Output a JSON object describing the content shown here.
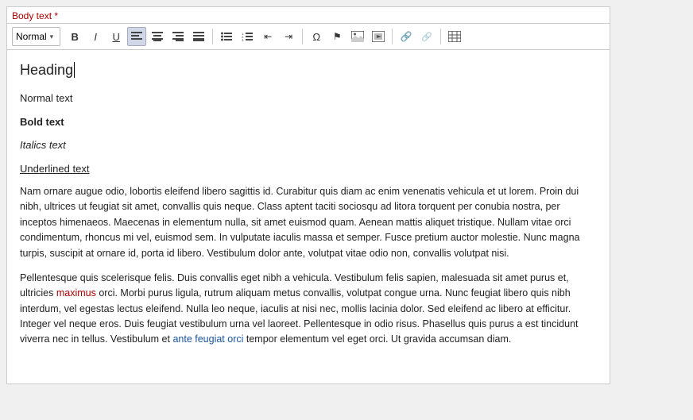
{
  "label": {
    "title": "Body text *"
  },
  "toolbar": {
    "style_select": "Normal",
    "buttons": [
      {
        "name": "bold-button",
        "label": "B",
        "style": "bold"
      },
      {
        "name": "italic-button",
        "label": "I",
        "style": "italic"
      },
      {
        "name": "underline-button",
        "label": "U",
        "style": "underline"
      },
      {
        "name": "align-left-button",
        "label": "≡",
        "icon": "align-left"
      },
      {
        "name": "align-center-button",
        "label": "≡",
        "icon": "align-center"
      },
      {
        "name": "align-right-button",
        "label": "≡",
        "icon": "align-right"
      },
      {
        "name": "justify-button",
        "label": "≡",
        "icon": "justify"
      },
      {
        "name": "list-unordered-button",
        "label": "☰",
        "icon": "ul"
      },
      {
        "name": "list-ordered-button",
        "label": "☰",
        "icon": "ol"
      },
      {
        "name": "indent-decrease-button",
        "label": "⇤"
      },
      {
        "name": "indent-increase-button",
        "label": "⇥"
      },
      {
        "name": "special-char-button",
        "label": "Ω"
      },
      {
        "name": "flag-button",
        "label": "⚑"
      },
      {
        "name": "image-button",
        "label": "⬛"
      },
      {
        "name": "table-special-button",
        "label": "⬛"
      },
      {
        "name": "link-button",
        "label": "🔗"
      },
      {
        "name": "unlink-button",
        "label": "🔗"
      },
      {
        "name": "table-button",
        "label": "⊞"
      }
    ]
  },
  "content": {
    "heading": "Heading",
    "normal_text": "Normal text",
    "bold_text": "Bold text",
    "italics_text": "Italics text",
    "underlined_text": "Underlined text",
    "paragraph1": "Nam ornare augue odio, lobortis eleifend libero sagittis id. Curabitur quis diam ac enim venenatis vehicula et ut lorem. Proin dui nibh, ultrices ut feugiat sit amet, convallis quis neque. Class aptent taciti sociosqu ad litora torquent per conubia nostra, per inceptos himenaeos. Maecenas in elementum nulla, sit amet euismod quam. Aenean mattis aliquet tristique. Nullam vitae orci condimentum, rhoncus mi vel, euismod sem. In vulputate iaculis massa et semper. Fusce pretium auctor molestie. Nunc magna turpis, suscipit at ornare id, porta id libero. Vestibulum dolor ante, volutpat vitae odio non, convallis volutpat nisi.",
    "paragraph2_parts": [
      {
        "text": "Pellentesque quis scelerisque felis. Duis convallis eget nibh a vehicula. Vestibulum felis sapien, malesuada sit amet purus et, ultricies ",
        "color": "normal"
      },
      {
        "text": "maximus",
        "color": "red"
      },
      {
        "text": " orci. Morbi purus ligula, rutrum aliquam metus convallis, volutpat congue urna. Nunc feugiat libero quis nibh interdum, vel egestas lectus eleifend. Nulla leo neque, iaculis at nisi nec, mollis lacinia dolor. Sed eleifend ac libero at efficitur. Integer vel neque eros. Duis feugiat vestibulum urna vel laoreet. Pellentesque in odio risus. Phasellus quis purus a est tincidunt viverra nec in tellus. Vestibulum et ",
        "color": "normal"
      },
      {
        "text": "ante feugiat orci",
        "color": "blue"
      },
      {
        "text": " tempor elementum vel eget orci. Ut gravida accumsan diam.",
        "color": "normal"
      }
    ]
  }
}
